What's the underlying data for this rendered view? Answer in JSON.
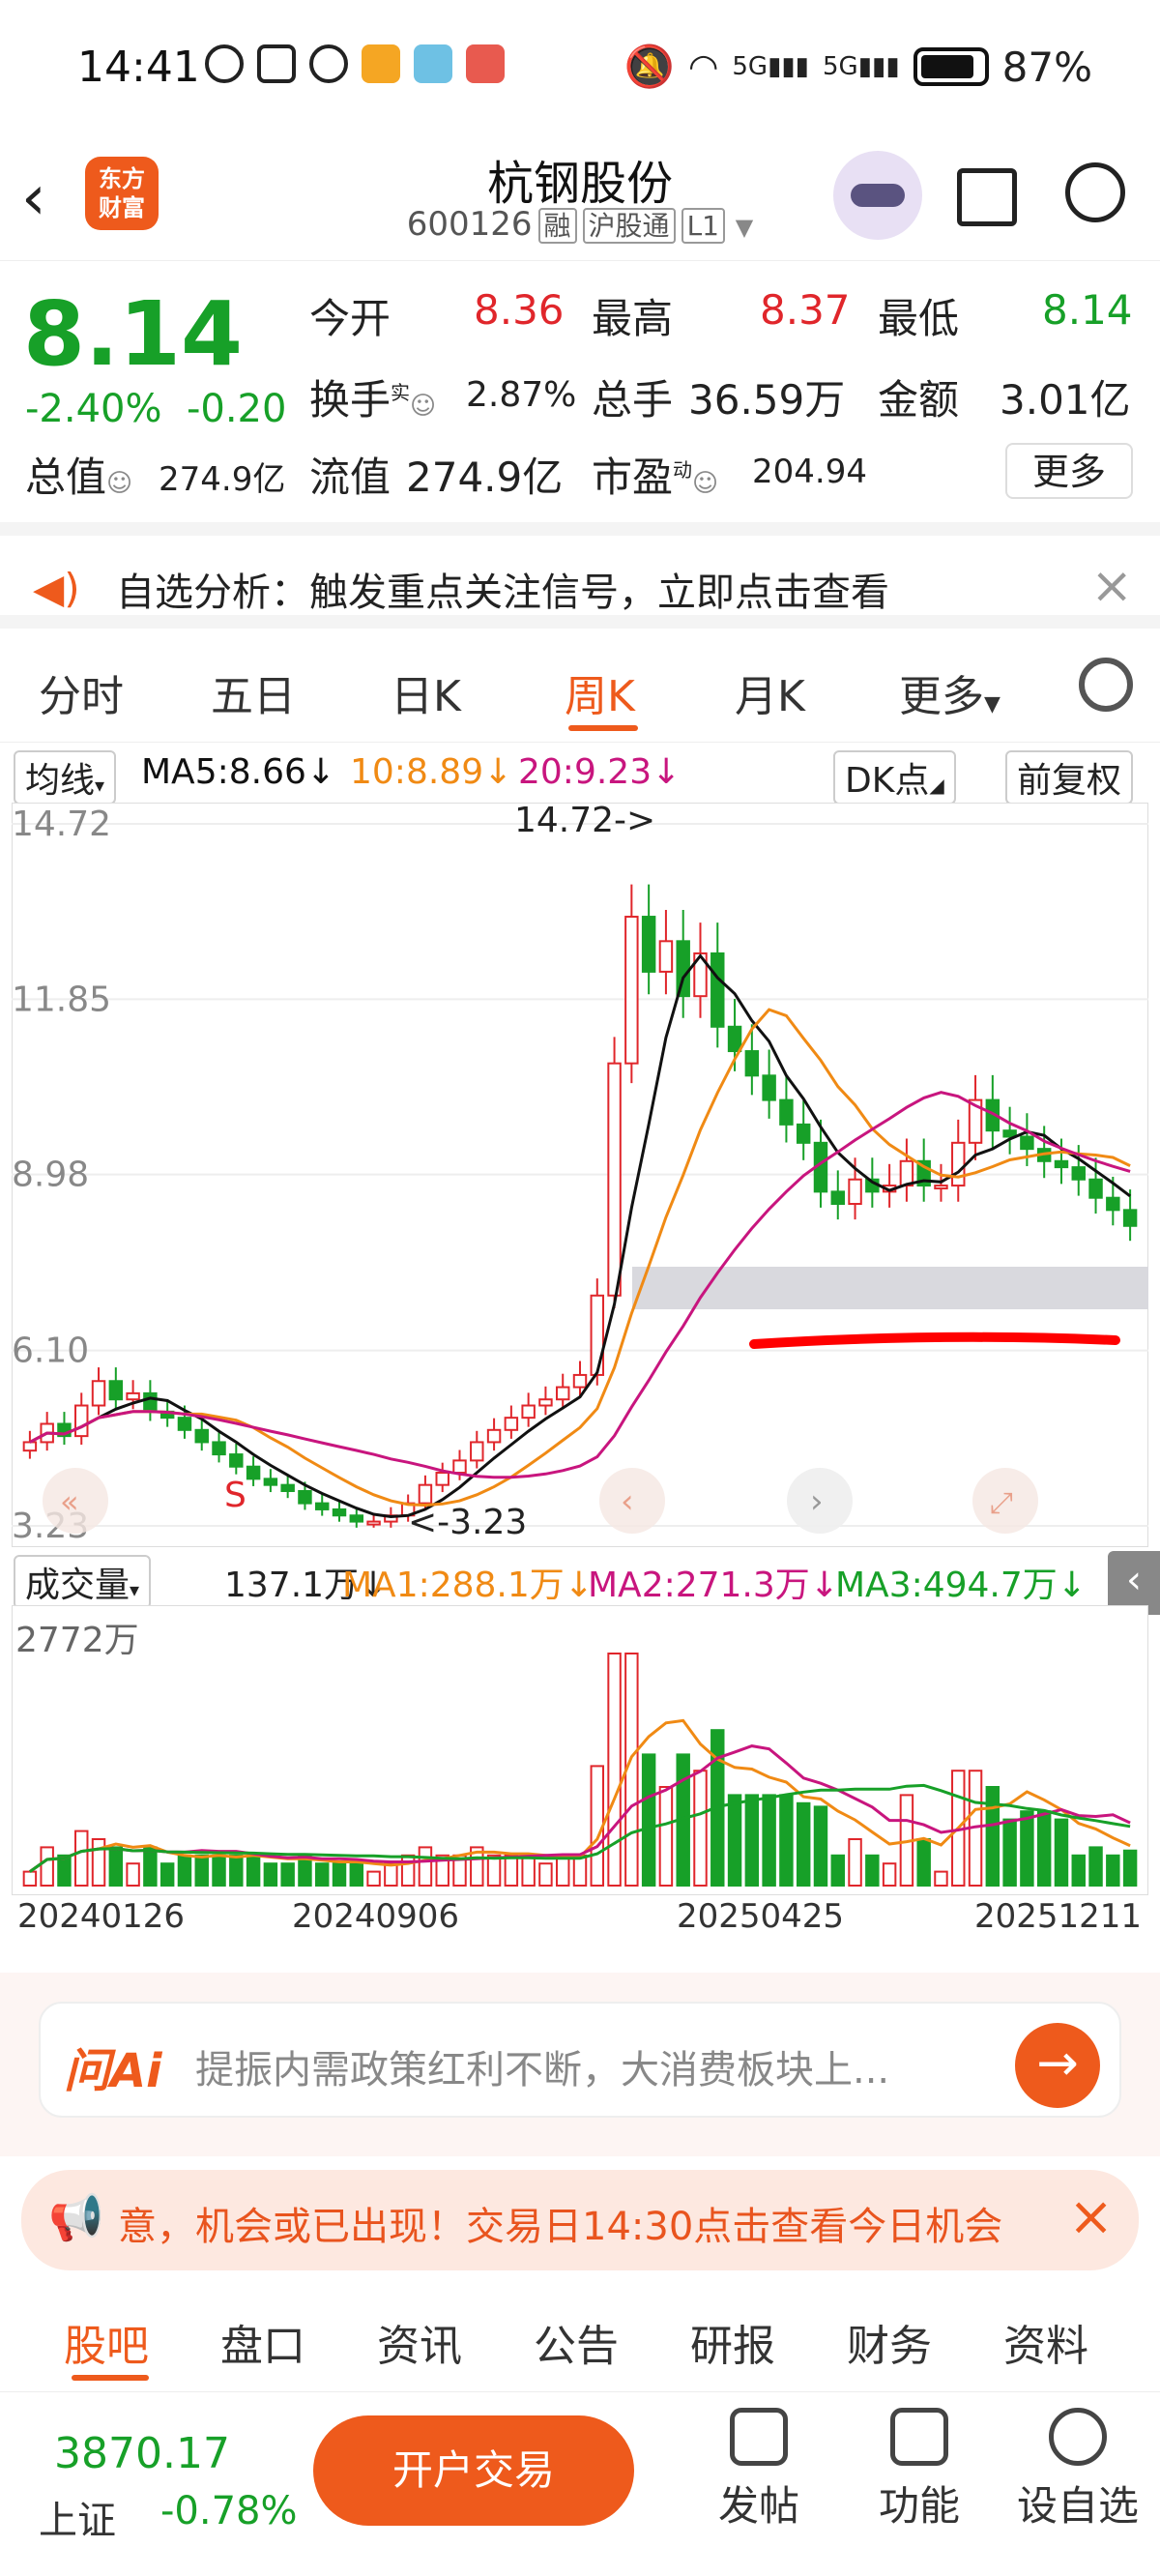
{
  "status": {
    "time": "14:41",
    "battery": "87%",
    "signal1": "5G",
    "signal2": "5G"
  },
  "header": {
    "name": "杭钢股份",
    "code": "600126",
    "tags": [
      "融",
      "沪股通",
      "L1"
    ],
    "logo_line1": "东方",
    "logo_line2": "财富"
  },
  "quote": {
    "price": "8.14",
    "change_pct": "-2.40%",
    "change": "-0.20",
    "open_label": "今开",
    "open": "8.36",
    "high_label": "最高",
    "high": "8.37",
    "low_label": "最低",
    "low": "8.14",
    "turnover_label": "换手",
    "turnover_sup": "实",
    "turnover": "2.87%",
    "volume_label": "总手",
    "volume": "36.59万",
    "amount_label": "金额",
    "amount": "3.01亿",
    "mcap_label": "总值",
    "mcap": "274.9亿",
    "float_label": "流值",
    "float": "274.9亿",
    "pe_label": "市盈",
    "pe_sup": "动",
    "pe": "204.94",
    "more": "更多"
  },
  "alert": {
    "text": "自选分析：触发重点关注信号，立即点击查看"
  },
  "period_tabs": [
    "分时",
    "五日",
    "日K",
    "周K",
    "月K",
    "更多"
  ],
  "active_period": "周K",
  "ma_legend": {
    "indicator": "均线",
    "ma5": "MA5:8.66↓",
    "ma10": "10:8.89↓",
    "ma20": "20:9.23↓",
    "dk": "DK点",
    "adjust": "前复权"
  },
  "kline_axis": [
    "14.72",
    "11.85",
    "8.98",
    "6.10",
    "3.23"
  ],
  "kline_annotations": {
    "high": "14.72->",
    "low": "<-3.23",
    "signal": "S"
  },
  "volume_legend": {
    "indicator": "成交量",
    "vol": "137.1万↓",
    "ma1": "MA1:288.1万↓",
    "ma2": "MA2:271.3万↓",
    "ma3": "MA3:494.7万↓",
    "axis_max": "2772万"
  },
  "dates": [
    "20240126",
    "20240906",
    "20250425",
    "20251211"
  ],
  "ai": {
    "logo": "问Ai",
    "placeholder": "提振内需政策红利不断，大消费板块上..."
  },
  "promo": {
    "text": "意，机会或已出现！交易日14:30点击查看今日机会"
  },
  "bottom_tabs": [
    "股吧",
    "盘口",
    "资讯",
    "公告",
    "研报",
    "财务",
    "资料"
  ],
  "footer": {
    "index_value": "3870.17",
    "index_name": "上证",
    "index_change": "-0.78%",
    "open_account": "开户交易",
    "post": "发帖",
    "func": "功能",
    "watch": "设自选"
  },
  "colors": {
    "up": "#e0262b",
    "down": "#17a028",
    "accent": "#ee5a1c",
    "ma5": "#111111",
    "ma10": "#f08a14",
    "ma20": "#c8157e"
  },
  "chart_data": {
    "type": "candlestick",
    "y_range": [
      3.23,
      14.72
    ],
    "period": "weekly",
    "close_series_approx": [
      4.6,
      4.9,
      4.7,
      5.2,
      5.6,
      5.3,
      5.4,
      5.1,
      5.0,
      4.8,
      4.6,
      4.4,
      4.2,
      4.0,
      3.9,
      3.8,
      3.6,
      3.5,
      3.4,
      3.3,
      3.3,
      3.4,
      3.6,
      3.9,
      4.1,
      4.3,
      4.6,
      4.8,
      5.0,
      5.2,
      5.3,
      5.5,
      5.7,
      7.0,
      10.8,
      13.2,
      12.3,
      12.8,
      11.9,
      12.6,
      11.4,
      11.0,
      10.6,
      10.2,
      9.8,
      9.5,
      8.7,
      8.5,
      8.9,
      8.7,
      8.8,
      9.2,
      8.8,
      8.8,
      9.5,
      10.2,
      9.7,
      9.6,
      9.4,
      9.2,
      9.1,
      8.9,
      8.6,
      8.4,
      8.14
    ],
    "volume_axis_max": "2772万"
  }
}
